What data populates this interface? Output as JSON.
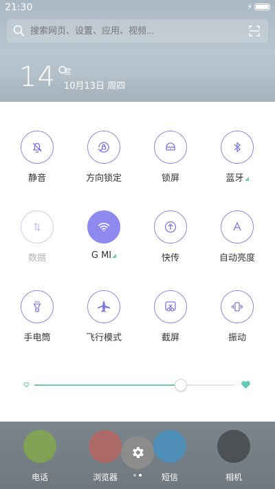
{
  "status_bar": {
    "time": "21:30",
    "charging_icon": "lightning-icon",
    "battery_icon": "battery-icon"
  },
  "search": {
    "placeholder": "搜索网页、设置、应用、视频..."
  },
  "weather": {
    "temperature": "14°",
    "condition": "雾",
    "date": "10月13日 周四"
  },
  "toggles": [
    {
      "label": "静音",
      "icon": "bell-off-icon",
      "state": "off"
    },
    {
      "label": "方向锁定",
      "icon": "rotation-lock-icon",
      "state": "off"
    },
    {
      "label": "锁屏",
      "icon": "lock-icon",
      "state": "off"
    },
    {
      "label": "蓝牙",
      "icon": "bluetooth-icon",
      "state": "off",
      "has_more": true
    },
    {
      "label": "数据",
      "icon": "mobile-data-icon",
      "state": "disabled"
    },
    {
      "label": "G  MI",
      "icon": "wifi-icon",
      "state": "on",
      "has_more": true
    },
    {
      "label": "快传",
      "icon": "quick-transfer-icon",
      "state": "off"
    },
    {
      "label": "自动亮度",
      "icon": "auto-brightness-icon",
      "state": "off"
    },
    {
      "label": "手电筒",
      "icon": "flashlight-icon",
      "state": "off"
    },
    {
      "label": "飞行模式",
      "icon": "airplane-icon",
      "state": "off"
    },
    {
      "label": "截屏",
      "icon": "screenshot-icon",
      "state": "off"
    },
    {
      "label": "振动",
      "icon": "vibrate-icon",
      "state": "off"
    }
  ],
  "brightness": {
    "level": 0.73,
    "low_icon": "heart-small-icon",
    "high_icon": "heart-large-icon"
  },
  "dock": [
    {
      "label": "电话",
      "icon": "phone-icon"
    },
    {
      "label": "浏览器",
      "icon": "browser-icon"
    },
    {
      "label": "短信",
      "icon": "messages-icon"
    },
    {
      "label": "相机",
      "icon": "camera-icon"
    }
  ],
  "pager": {
    "pages": 2,
    "current": 2
  },
  "colors": {
    "accent": "#8e89ee",
    "toggle_border": "#8b86e6",
    "brightness_fill": "#66c9b5",
    "panel_bg": "#ffffff"
  }
}
